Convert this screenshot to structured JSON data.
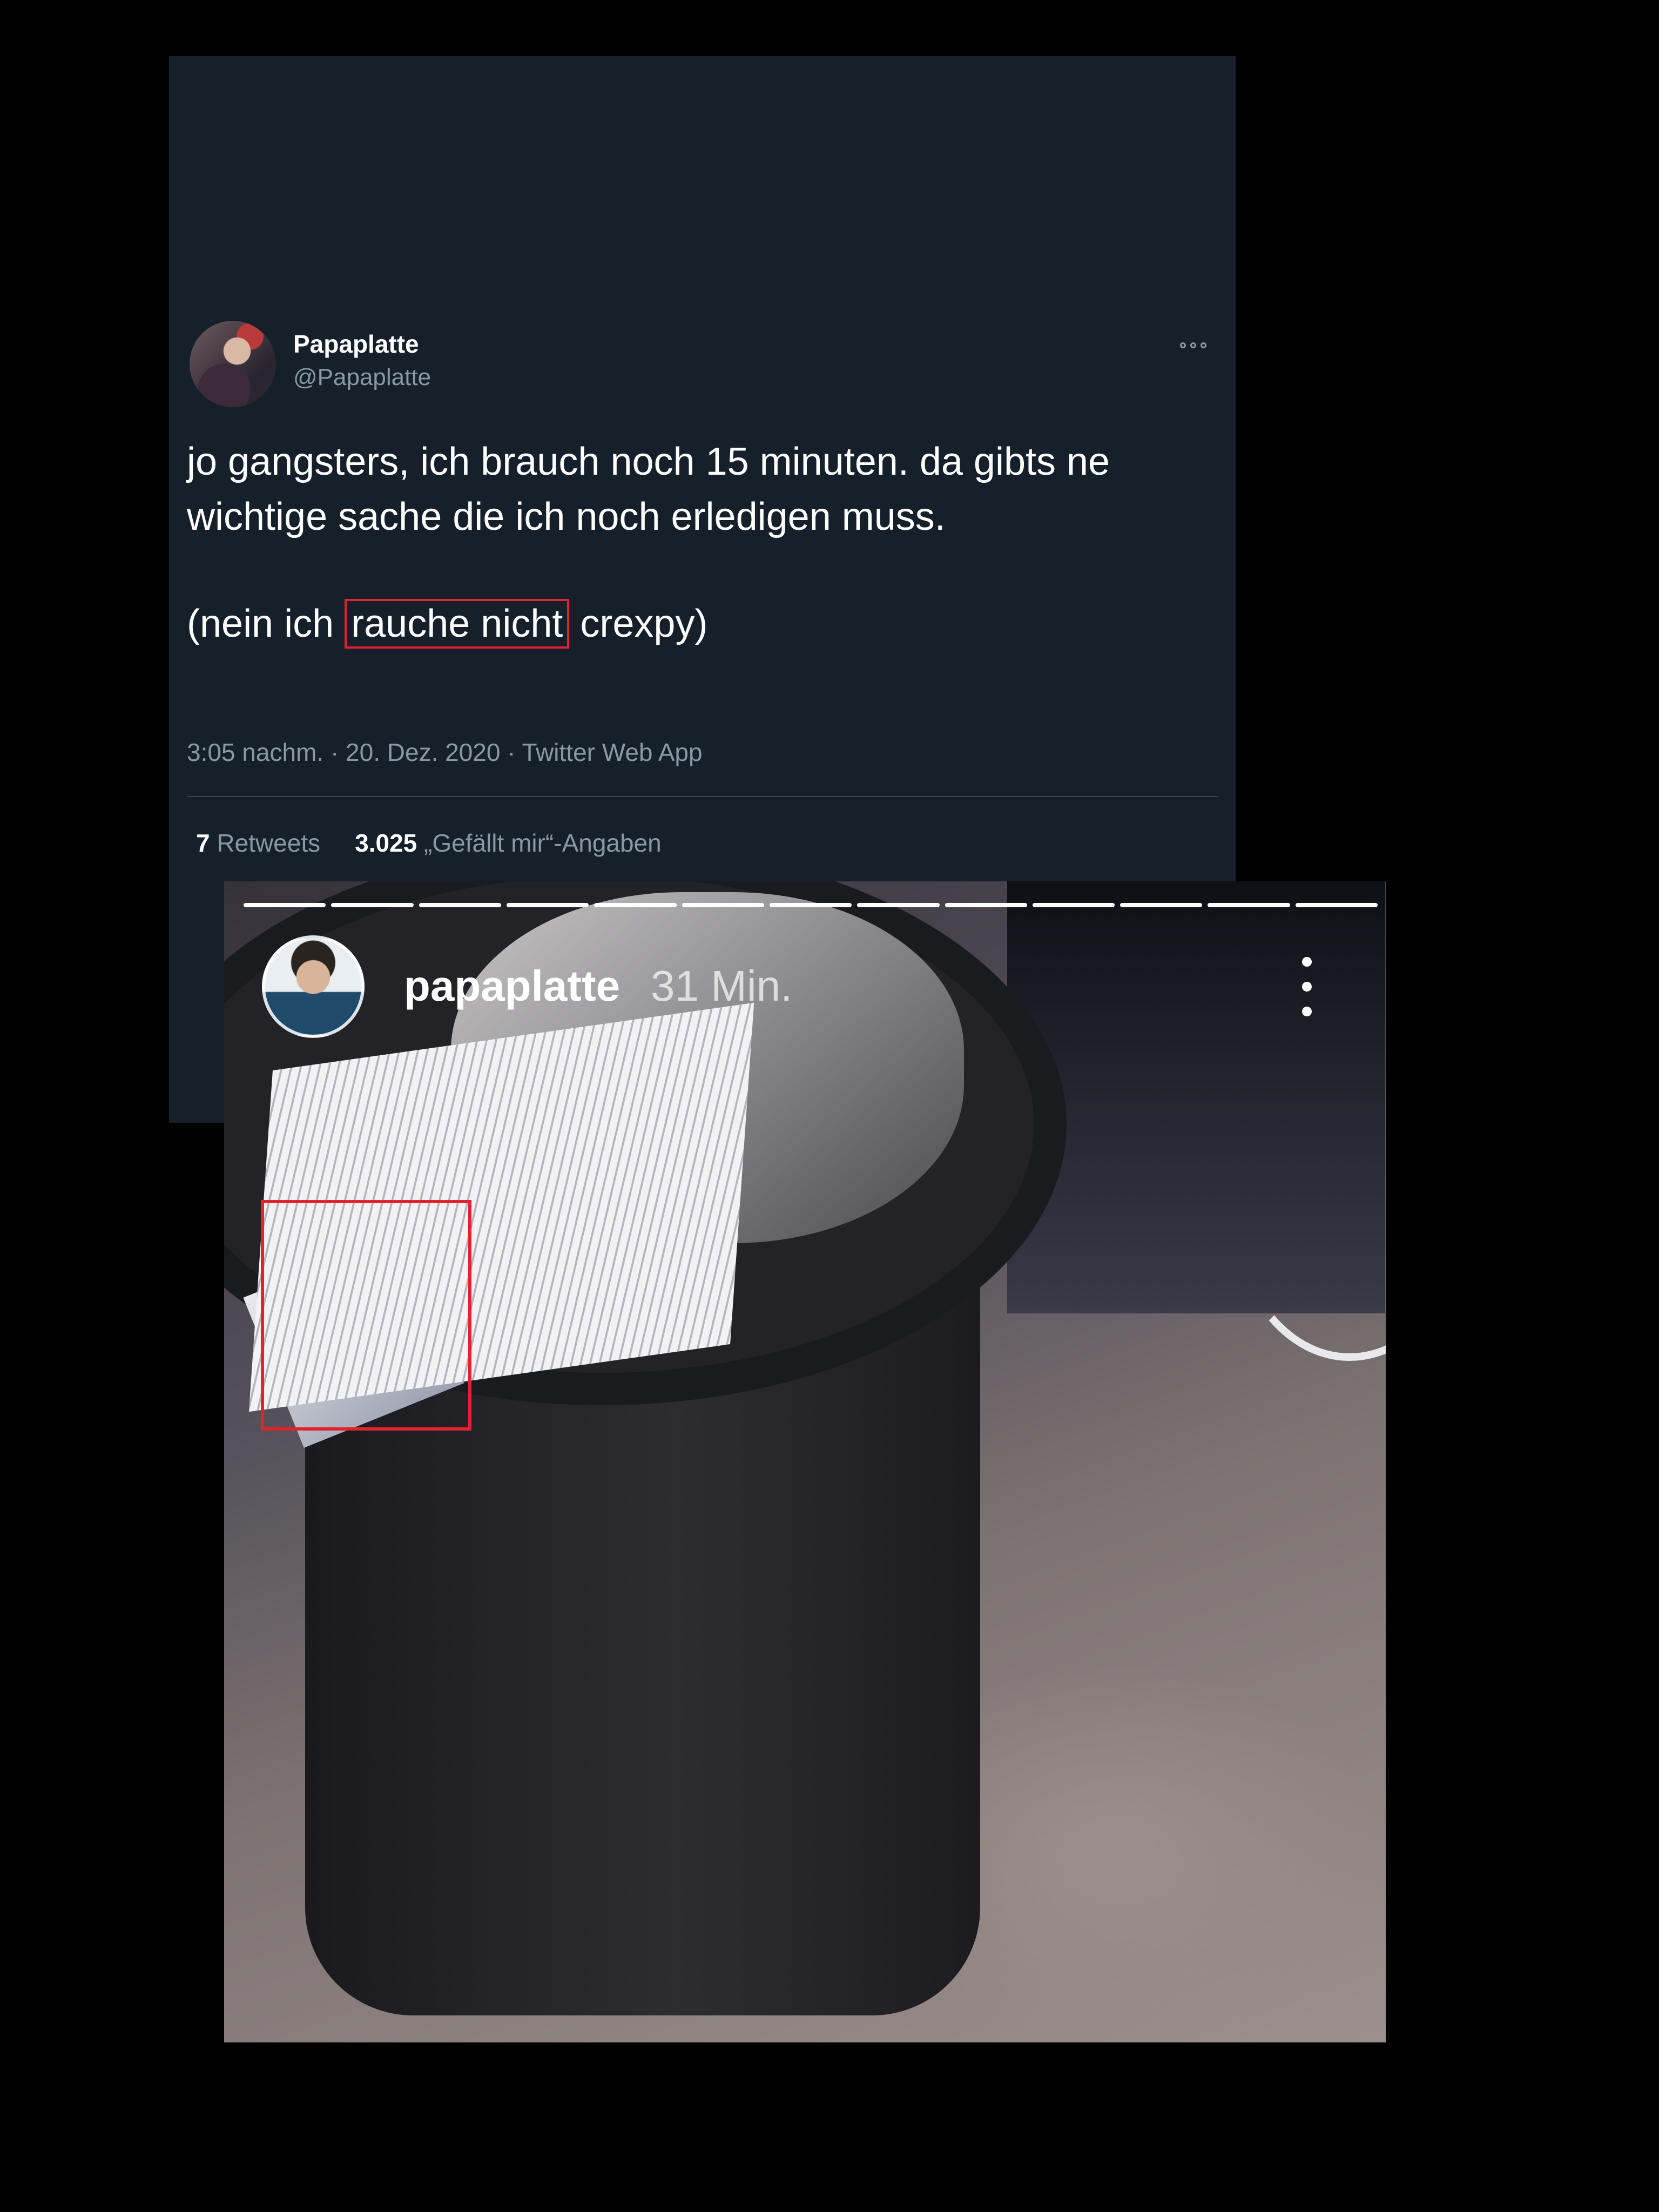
{
  "tweet": {
    "display_name": "Papaplatte",
    "handle": "@Papaplatte",
    "text_line1": "jo gangsters, ich brauch noch 15 minuten. da gibts ne",
    "text_line2": "wichtige sache die ich noch erledigen muss.",
    "text_p2_before": "(nein ich ",
    "text_p2_highlight": "rauche nicht",
    "text_p2_after": " crexpy)",
    "meta": "3:05 nachm. · 20. Dez. 2020 · Twitter Web App",
    "retweets_count": "7",
    "retweets_label": "Retweets",
    "likes_count": "3.025",
    "likes_label": "„Gefällt mir“-Angaben",
    "highlight_color": "#e0232e"
  },
  "story": {
    "username": "papaplatte",
    "time": "31 Min.",
    "progress_segments": 13,
    "highlight_color": "#e0232e"
  }
}
